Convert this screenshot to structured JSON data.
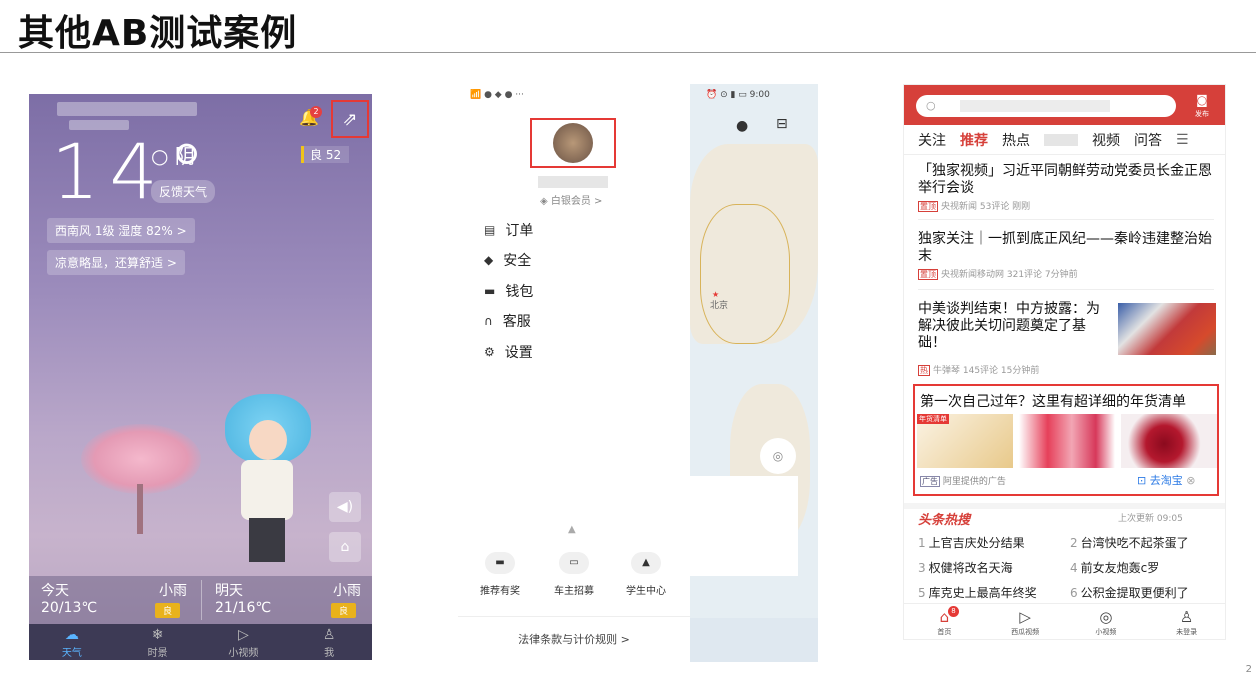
{
  "slide": {
    "title": "其他AB测试案例",
    "page_number": "2"
  },
  "weather": {
    "temperature": "14°",
    "condition": "阴",
    "feedback_label": "反馈天气",
    "aqi": "良 52",
    "wind_humidity": "西南风 1级  湿度 82% >",
    "comfort": "凉意略显，还算舒适 >",
    "notification_count": "2",
    "forecast": [
      {
        "day": "今天",
        "weather": "小雨",
        "temps": "20/13℃",
        "quality": "良"
      },
      {
        "day": "明天",
        "weather": "小雨",
        "temps": "21/16℃",
        "quality": "良"
      }
    ],
    "tabs": [
      {
        "label": "天气",
        "icon": "cloud-icon"
      },
      {
        "label": "时景",
        "icon": "snowflake-icon"
      },
      {
        "label": "小视频",
        "icon": "play-icon"
      },
      {
        "label": "我",
        "icon": "user-icon"
      }
    ]
  },
  "drawer": {
    "status_time": "9:00",
    "member_label": "白银会员 >",
    "menu": [
      {
        "label": "订单",
        "icon": "order-icon"
      },
      {
        "label": "安全",
        "icon": "security-icon"
      },
      {
        "label": "钱包",
        "icon": "wallet-icon"
      },
      {
        "label": "客服",
        "icon": "service-icon"
      },
      {
        "label": "设置",
        "icon": "settings-icon"
      }
    ],
    "shortcuts": [
      "推荐有奖",
      "车主招募",
      "学生中心"
    ],
    "legal_link": "法律条款与计价规则 >",
    "map_label": "北京"
  },
  "news": {
    "publish_label": "发布",
    "channels": [
      "关注",
      "推荐",
      "热点",
      "视频",
      "问答"
    ],
    "articles": [
      {
        "title": "「独家视频」习近平同朝鲜劳动党委员长金正恩举行会谈",
        "tag": "置顶",
        "meta": "央视新闻 53评论 刚刚"
      },
      {
        "title": "独家关注｜一抓到底正风纪——秦岭违建整治始末",
        "tag": "置顶",
        "meta": "央视新闻移动网 321评论 7分钟前"
      },
      {
        "title": "中美谈判结束！中方披露：为解决彼此关切问题奠定了基础！",
        "tag": "热",
        "meta": "牛弹琴 145评论 15分钟前"
      }
    ],
    "ad": {
      "title": "第一次自己过年？这里有超详细的年货清单",
      "badge": "年货清单",
      "source": "阿里提供的广告",
      "source_tag": "广告",
      "cta": "去淘宝"
    },
    "hot": {
      "title": "头条热搜",
      "updated": "上次更新 09:05",
      "items": [
        {
          "n": "1",
          "text": "上官吉庆处分结果"
        },
        {
          "n": "2",
          "text": "台湾快吃不起茶蛋了"
        },
        {
          "n": "3",
          "text": "权健将改名天海"
        },
        {
          "n": "4",
          "text": "前女友炮轰c罗"
        },
        {
          "n": "5",
          "text": "库克史上最高年终奖"
        },
        {
          "n": "6",
          "text": "公积金提取更便利了"
        }
      ]
    },
    "bottom_tabs": [
      {
        "label": "首页",
        "icon": "home-icon"
      },
      {
        "label": "西瓜视频",
        "icon": "video-icon"
      },
      {
        "label": "小视频",
        "icon": "short-video-icon"
      },
      {
        "label": "未登录",
        "icon": "user-icon"
      }
    ],
    "home_badge": "8"
  }
}
